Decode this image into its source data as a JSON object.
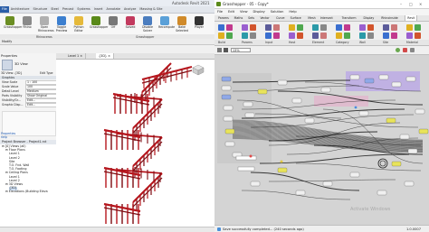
{
  "revit": {
    "title": "Autodesk Revit 2021",
    "tabs": [
      "File",
      "Architecture",
      "Structure",
      "Steel",
      "Precast",
      "Systems",
      "Insert",
      "Annotate",
      "Analyze",
      "Massing & Site"
    ],
    "ribbon_buttons": [
      {
        "label": "Grasshopper",
        "icon": "grasshopper-icon",
        "color": "#6b8e23"
      },
      {
        "label": "Rhino",
        "icon": "rhino-icon",
        "color": "#8a8a8a"
      },
      {
        "label": "Open Rhinoceros",
        "icon": "rhino-open-icon",
        "color": "#b0b0b0"
      },
      {
        "label": "Toggle Preview",
        "icon": "toggle-preview-icon",
        "color": "#3c7fcf"
      },
      {
        "label": "Python Editor",
        "icon": "python-icon",
        "color": "#e5b93a"
      },
      {
        "label": "Grasshopper",
        "icon": "grasshopper-icon",
        "color": "#5a8a1a"
      },
      {
        "label": "Off",
        "icon": "off-icon",
        "color": "#777777"
      },
      {
        "label": "Solved",
        "icon": "solved-icon",
        "color": "#c23a5e"
      },
      {
        "label": "Disable Solver",
        "icon": "disable-solver-icon",
        "color": "#4b7dbf"
      },
      {
        "label": "Recompute",
        "icon": "recompute-icon",
        "color": "#5aa0d8"
      },
      {
        "label": "Bake Selected",
        "icon": "bake-icon",
        "color": "#d08a2a"
      },
      {
        "label": "Player",
        "icon": "player-icon",
        "color": "#333333"
      }
    ],
    "panel_labels": [
      "Rhinoceros",
      "Grasshopper"
    ],
    "modify": "Modify",
    "properties": {
      "title": "Properties",
      "type": "3D View",
      "selector": "3D View: {3D}",
      "edit_type": "Edit Type",
      "group": "Graphics",
      "rows": [
        {
          "k": "View Scale",
          "v": "1 : 100"
        },
        {
          "k": "Scale Value",
          "v": "100"
        },
        {
          "k": "Detail Level",
          "v": "Medium"
        },
        {
          "k": "Parts Visibility",
          "v": "Show Original"
        },
        {
          "k": "Visibility/Gr...",
          "v": "Edit..."
        },
        {
          "k": "Graphic Disp...",
          "v": "Edit..."
        }
      ],
      "help": "Properties help"
    },
    "browser": {
      "title": "Project Browser - Project1.rvt",
      "items": [
        {
          "t": "[0] Views (all)",
          "lvl": 0
        },
        {
          "t": "Floor Plans",
          "lvl": 1
        },
        {
          "t": "Level 1",
          "lvl": 2
        },
        {
          "t": "Level 2",
          "lvl": 2
        },
        {
          "t": "Site",
          "lvl": 2
        },
        {
          "t": "T.O. Fnd. Wall",
          "lvl": 2
        },
        {
          "t": "T.O. Footing",
          "lvl": 2
        },
        {
          "t": "Ceiling Plans",
          "lvl": 1
        },
        {
          "t": "Level 1",
          "lvl": 2
        },
        {
          "t": "Level 2",
          "lvl": 2
        },
        {
          "t": "3D Views",
          "lvl": 1
        },
        {
          "t": "{3D}",
          "lvl": 2
        },
        {
          "t": "Elevations (Building Eleva",
          "lvl": 1
        }
      ]
    },
    "view_tabs": [
      "Level 1",
      "{3D}"
    ],
    "status": ""
  },
  "gh": {
    "title": "Grasshopper - 05 - Copy*",
    "menu": [
      "File",
      "Edit",
      "View",
      "Display",
      "Solution",
      "Help"
    ],
    "component_tabs": [
      "Params",
      "Maths",
      "Sets",
      "Vector",
      "Curve",
      "Surface",
      "Mesh",
      "Intersect",
      "Transform",
      "Display",
      "Rhinoinside",
      "Revit"
    ],
    "active_tab": "Revit",
    "category_labels": [
      "Build",
      "Params",
      "Input",
      "Host",
      "Element",
      "Category",
      "Wall",
      "Site",
      "Material"
    ],
    "zoom": "13%",
    "status": "Save successfully completed... (240 seconds ago)",
    "version": "1.0.0007",
    "watermark": "Activate Windows",
    "colors": {
      "wire": "#1a1a1a",
      "group_purple": "#b9a6e8",
      "group_pink": "#e8a8c8",
      "comp_blue": "#8fa8e8",
      "comp_yellow": "#e8e35a"
    }
  }
}
